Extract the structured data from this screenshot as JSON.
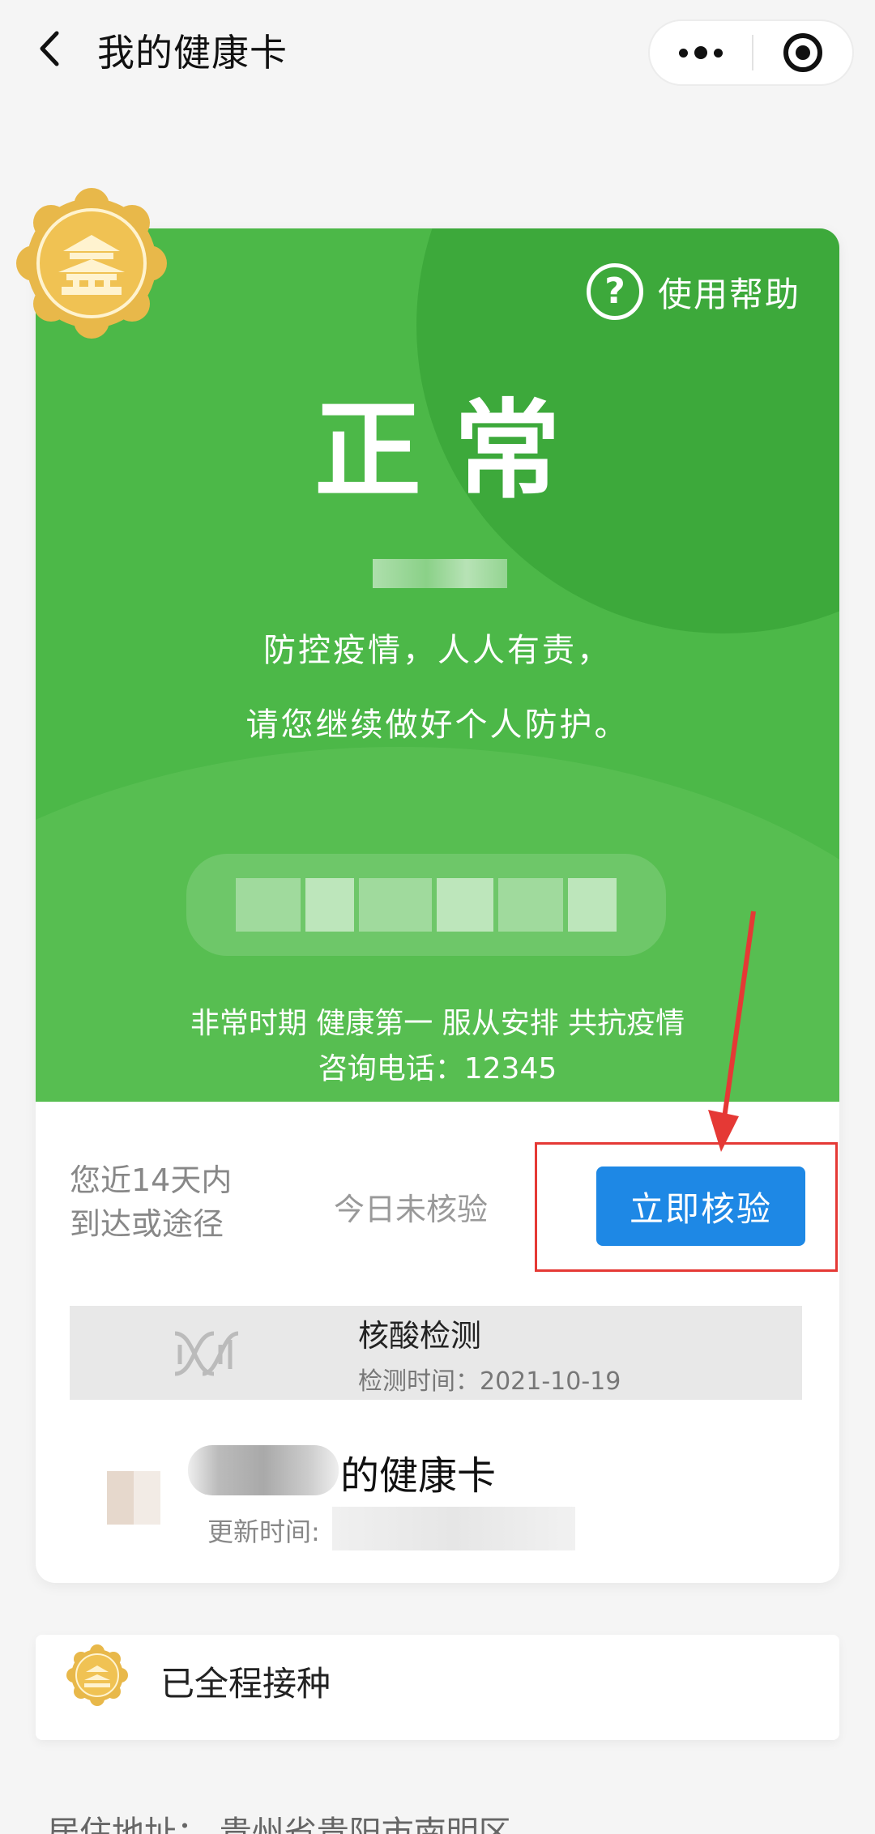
{
  "navbar": {
    "title": "我的健康卡",
    "back_icon": "chevron-left-icon",
    "more_icon": "more-dots-icon",
    "close_icon": "target-icon"
  },
  "card": {
    "help_label": "使用帮助",
    "status": "正常",
    "slogan_line1": "防控疫情，人人有责，",
    "slogan_line2": "请您继续做好个人防护。",
    "footer_line1": "非常时期 健康第一 服从安排 共抗疫情",
    "footer_line2": "咨询电话：12345",
    "status_color": "#4cb848"
  },
  "verification": {
    "trip_line1": "您近14天内",
    "trip_line2": "到达或途径",
    "status": "今日未核验",
    "button_label": "立即核验",
    "button_color": "#1e88e5",
    "highlight_color": "#e53935"
  },
  "nucleic_test": {
    "title": "核酸检测",
    "time": "检测时间：2021-10-19"
  },
  "owner": {
    "label": "的健康卡",
    "update_label": "更新时间:"
  },
  "vaccine": {
    "label": "已全程接种"
  },
  "bottom": {
    "text": "居住地址：   贵州省贵阳市南明区... "
  }
}
